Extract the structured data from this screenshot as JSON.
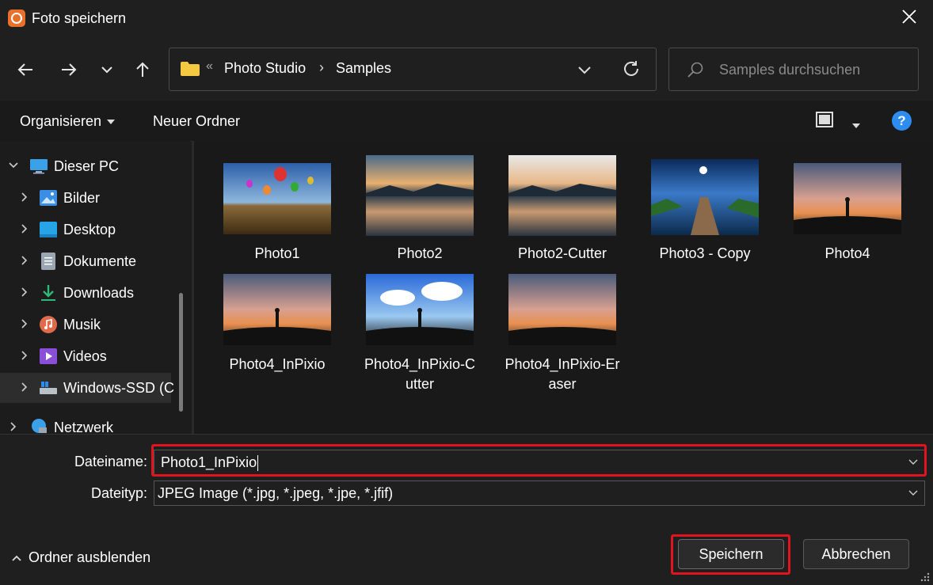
{
  "window": {
    "title": "Foto speichern",
    "close_glyph": "✕"
  },
  "navigation": {
    "back_icon": "arrow-left-icon",
    "forward_icon": "arrow-right-icon",
    "recent_icon": "chevron-down-icon",
    "up_icon": "arrow-up-icon",
    "address": {
      "overflow_glyph": "«",
      "breadcrumbs": [
        "Photo Studio",
        "Samples"
      ],
      "separator": "›"
    },
    "search_placeholder": "Samples durchsuchen"
  },
  "toolbar": {
    "organize_label": "Organisieren",
    "new_folder_label": "Neuer Ordner",
    "help_glyph": "?"
  },
  "sidebar": {
    "items": [
      {
        "label": "Dieser PC",
        "icon": "monitor-icon",
        "expanded": true
      },
      {
        "label": "Bilder",
        "icon": "pictures-icon"
      },
      {
        "label": "Desktop",
        "icon": "desktop-icon"
      },
      {
        "label": "Dokumente",
        "icon": "documents-icon"
      },
      {
        "label": "Downloads",
        "icon": "download-icon"
      },
      {
        "label": "Musik",
        "icon": "music-icon"
      },
      {
        "label": "Videos",
        "icon": "videos-icon"
      },
      {
        "label": "Windows-SSD (C",
        "icon": "drive-icon",
        "selected": true
      },
      {
        "label": "Netzwerk",
        "icon": "network-icon"
      }
    ]
  },
  "files": [
    {
      "name": "Photo1"
    },
    {
      "name": "Photo2"
    },
    {
      "name": "Photo2-Cutter"
    },
    {
      "name": "Photo3 - Copy"
    },
    {
      "name": "Photo4"
    },
    {
      "name": "Photo4_InPixio"
    },
    {
      "name": "Photo4_InPixio-C",
      "name_line2": "utter"
    },
    {
      "name": "Photo4_InPixio-Er",
      "name_line2": "aser"
    }
  ],
  "form": {
    "filename_label": "Dateiname:",
    "filename_value": "Photo1_InPixio",
    "filetype_label": "Dateityp:",
    "filetype_value": "JPEG Image (*.jpg, *.jpeg, *.jpe, *.jfif)"
  },
  "footer": {
    "hide_folders_label": "Ordner ausblenden",
    "save_label": "Speichern",
    "cancel_label": "Abbrechen"
  },
  "colors": {
    "highlight": "#e0141d",
    "accent": "#2d8cf0",
    "app_icon": "#e8702a",
    "folder": "#f5c842"
  }
}
